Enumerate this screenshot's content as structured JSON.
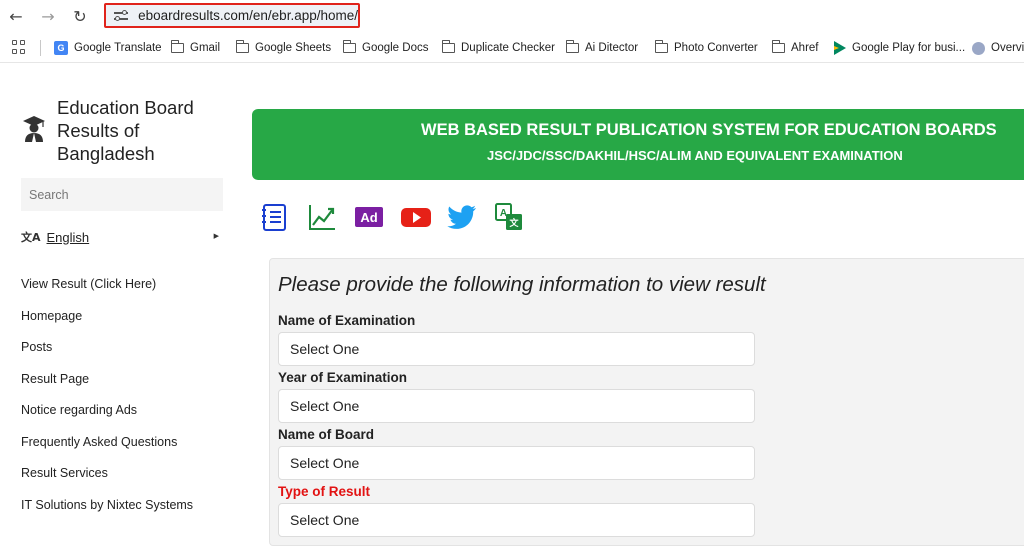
{
  "browser": {
    "url": "eboardresults.com/en/ebr.app/home/",
    "bookmarks": [
      {
        "label": "Google Translate",
        "icon": "google-translate-icon"
      },
      {
        "label": "Gmail",
        "icon": "folder-icon"
      },
      {
        "label": "Google Sheets",
        "icon": "folder-icon"
      },
      {
        "label": "Google Docs",
        "icon": "folder-icon"
      },
      {
        "label": "Duplicate Checker",
        "icon": "folder-icon"
      },
      {
        "label": "Ai Ditector",
        "icon": "folder-icon"
      },
      {
        "label": "Photo Converter",
        "icon": "folder-icon"
      },
      {
        "label": "Ahref",
        "icon": "folder-icon"
      },
      {
        "label": "Google Play for busi...",
        "icon": "google-play-icon"
      },
      {
        "label": "Overvie",
        "icon": "globe-icon"
      }
    ]
  },
  "sidebar": {
    "site_title": "Education Board Results of Bangladesh",
    "search_placeholder": "Search",
    "language": "English",
    "nav": [
      "View Result (Click Here)",
      "Homepage",
      "Posts",
      "Result Page",
      "Notice regarding Ads",
      "Frequently Asked Questions",
      "Result Services",
      "IT Solutions by Nixtec Systems"
    ]
  },
  "banner": {
    "title": "WEB BASED RESULT PUBLICATION SYSTEM FOR EDUCATION BOARDS",
    "subtitle": "JSC/JDC/SSC/DAKHIL/HSC/ALIM AND EQUIVALENT EXAMINATION"
  },
  "social_icons": [
    "notice-icon",
    "chart-icon",
    "ad-icon",
    "youtube-icon",
    "twitter-icon",
    "translate-icon"
  ],
  "colors": {
    "banner_green": "#27a846",
    "highlight_red": "#e21212",
    "ad_purple": "#7b1fa2",
    "youtube_red": "#e62117",
    "twitter_blue": "#1da1f2"
  },
  "form": {
    "heading": "Please provide the following information to view result",
    "fields": [
      {
        "label": "Name of Examination",
        "value": "Select One"
      },
      {
        "label": "Year of Examination",
        "value": "Select One"
      },
      {
        "label": "Name of Board",
        "value": "Select One"
      },
      {
        "label": "Type of Result",
        "value": "Select One"
      }
    ]
  }
}
